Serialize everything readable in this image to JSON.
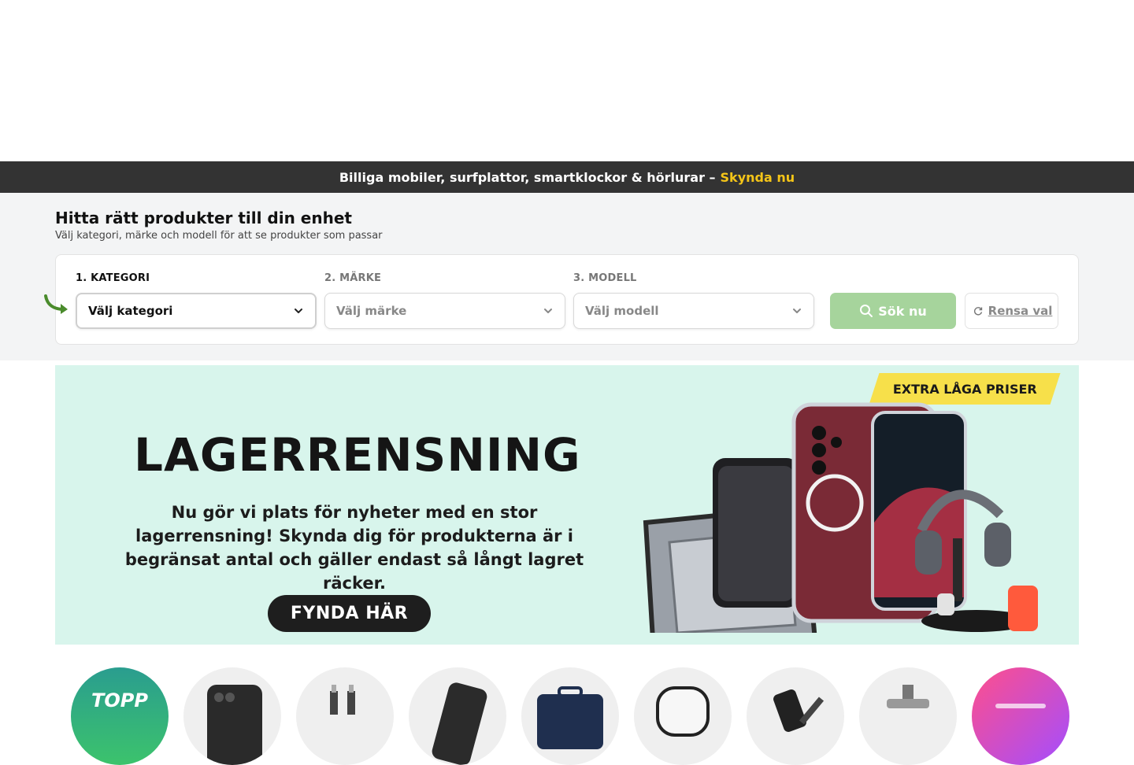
{
  "promo": {
    "text": "Billiga mobiler, surfplattor, smartklockor & hörlurar –",
    "cta": "Skynda nu"
  },
  "finder": {
    "title": "Hitta rätt produkter till din enhet",
    "subtitle": "Välj kategori, märke och modell för att se produkter som passar",
    "steps": [
      {
        "label": "1. KATEGORI",
        "placeholder": "Välj kategori"
      },
      {
        "label": "2. MÄRKE",
        "placeholder": "Välj märke"
      },
      {
        "label": "3. MODELL",
        "placeholder": "Välj modell"
      }
    ],
    "search_label": "Sök nu",
    "reset_label": "Rensa val"
  },
  "banner": {
    "tag": "EXTRA LÅGA PRISER",
    "headline": "LAGERRENSNING",
    "text": "Nu gör vi plats för nyheter med en stor lagerrensning! Skynda dig för produkterna är i begränsat antal och gäller endast så långt lagret räcker.",
    "cta": "FYNDA HÄR"
  },
  "categories": [
    {
      "label": "TOPP",
      "icon": "topp-icon"
    },
    {
      "label": "",
      "icon": "phone-case-icon"
    },
    {
      "label": "",
      "icon": "cable-icon"
    },
    {
      "label": "",
      "icon": "powerbank-icon"
    },
    {
      "label": "",
      "icon": "laptop-bag-icon"
    },
    {
      "label": "",
      "icon": "airpods-case-icon"
    },
    {
      "label": "",
      "icon": "wireless-charger-icon"
    },
    {
      "label": "",
      "icon": "car-holder-icon"
    },
    {
      "label": "",
      "icon": "campaign-icon"
    }
  ],
  "colors": {
    "promo_bg": "#333333",
    "promo_cta": "#f5c518",
    "search_btn": "#a6d49c",
    "banner_bg": "#d8f5ec",
    "arrow": "#4a8b2c"
  }
}
